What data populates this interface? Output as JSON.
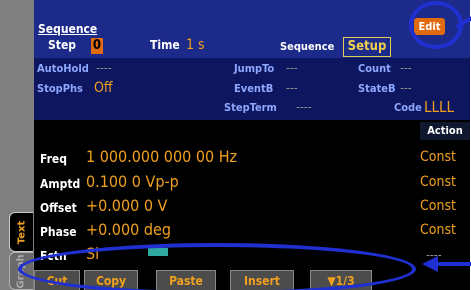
{
  "tabs": {
    "text": "Text",
    "graph": "Graph"
  },
  "header": {
    "title": "Sequence",
    "step_label": "Step",
    "step_value": "0",
    "time_label": "Time",
    "time_value": "1 s",
    "sequence_label": "Sequence",
    "setup_button": "Setup",
    "edit_button": "Edit"
  },
  "params": {
    "autohold_label": "AutoHold",
    "autohold_value": "----",
    "jumpto_label": "JumpTo",
    "jumpto_value": "---",
    "count_label": "Count",
    "count_value": "---",
    "stopphs_label": "StopPhs",
    "stopphs_value": "Off",
    "eventb_label": "EventB",
    "eventb_value": "---",
    "stateb_label": "StateB",
    "stateb_value": "---",
    "stepterm_label": "StepTerm",
    "stepterm_value": "----",
    "code_label": "Code",
    "code_value": "LLLL"
  },
  "table": {
    "action_header": "Action",
    "rows": [
      {
        "label": "Freq",
        "value": "1 000.000 000 00 Hz",
        "action": "Const"
      },
      {
        "label": "Amptd",
        "value": "0.100 0 Vp-p",
        "action": "Const"
      },
      {
        "label": "Offset",
        "value": "+0.000 0 V",
        "action": "Const"
      },
      {
        "label": "Phase",
        "value": "+0.000 deg",
        "action": "Const"
      },
      {
        "label": "Fctn",
        "value": "Si",
        "action": "----"
      }
    ]
  },
  "softkeys": [
    "Cut",
    "Copy",
    "Paste",
    "Insert",
    "▼1/3"
  ],
  "colors": {
    "accent": "#f0a020",
    "header_bg": "#1c2a8a",
    "callout": "#2030d0",
    "edit_bg": "#e06a10"
  }
}
